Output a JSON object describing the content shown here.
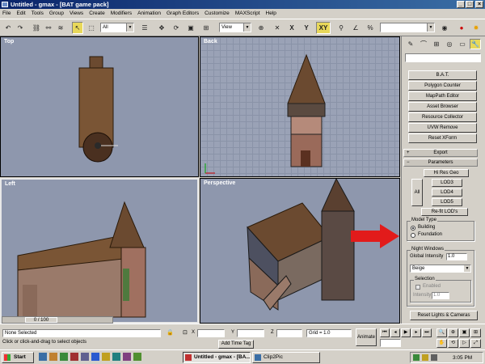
{
  "window": {
    "title": "Untitled - gmax - [BAT game pack]"
  },
  "menu": [
    "File",
    "Edit",
    "Tools",
    "Group",
    "Views",
    "Create",
    "Modifiers",
    "Animation",
    "Graph Editors",
    "Customize",
    "MAXScript",
    "Help"
  ],
  "toolbar": {
    "selection_filter": "All",
    "coord_system": "View",
    "axis_constraint": [
      "X",
      "Y",
      "Z",
      "XY"
    ]
  },
  "viewports": {
    "top": "Top",
    "back": "Back",
    "left": "Left",
    "perspective": "Perspective"
  },
  "panel": {
    "utilities": [
      "B.A.T.",
      "Polygon Counter",
      "MapPath Editor",
      "Asset Browser",
      "Resource Collector",
      "UVW Remove",
      "Reset XForm"
    ],
    "export_rollout": "Export",
    "parameters_rollout": "Parameters",
    "params": {
      "hires": "Hi Res Geo",
      "all": "All",
      "lods": [
        "LOD3",
        "LOD4",
        "LOD5"
      ],
      "refit": "Re-fit LOD's"
    },
    "model_type": {
      "title": "Model Type",
      "options": [
        "Building",
        "Foundation"
      ],
      "selected": "Building"
    },
    "night": {
      "title": "Night Windows",
      "global_intensity_label": "Global Intensity",
      "global_intensity_value": "1.0",
      "color": "Beige",
      "selection_title": "Selection",
      "enabled_label": "Enabled",
      "intensity_label": "Intensity",
      "intensity_value": "1.0"
    },
    "reset_lights": "Reset Lights & Cameras"
  },
  "status": {
    "time_slider": "0 / 100",
    "selection": "None Selected",
    "prompt": "Click or click-and-drag to select objects",
    "x_label": "X",
    "y_label": "Y",
    "z_label": "Z",
    "grid": "Grid = 1.0",
    "add_time_tag": "Add Time Tag",
    "animate": "Animate"
  },
  "taskbar": {
    "start": "Start",
    "tasks": [
      "Untitled - gmax - [BA...",
      "Clip2Pic"
    ],
    "clock": "3:05 PM"
  },
  "colors": {
    "arrow": "#e21b1b",
    "active_button": "#e8d85a",
    "viewport_bg": "#8e97ad"
  }
}
